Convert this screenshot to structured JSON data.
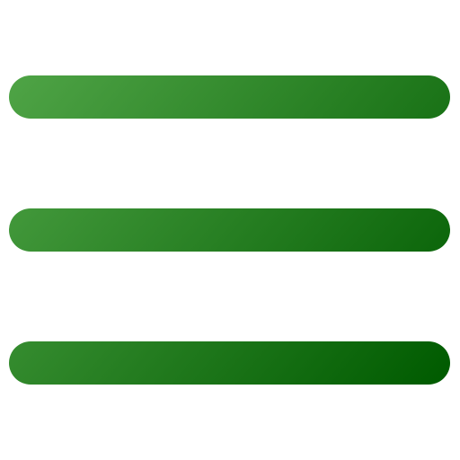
{
  "icon": {
    "name": "hamburger-menu-icon",
    "bar_count": 3,
    "colors": {
      "gradient_light": "#4fa446",
      "gradient_dark": "#005b00",
      "background": "#ffffff"
    }
  }
}
